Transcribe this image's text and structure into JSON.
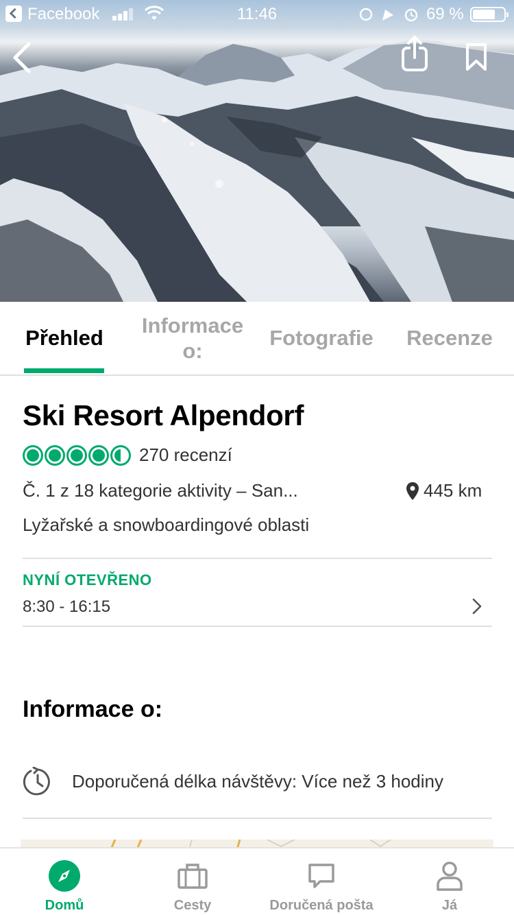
{
  "status_bar": {
    "back_app": "Facebook",
    "time": "11:46",
    "battery_percent": "69 %"
  },
  "hero": {
    "back_icon": "chevron-left-icon",
    "share_icon": "share-icon",
    "bookmark_icon": "bookmark-icon"
  },
  "tabs": [
    {
      "label": "Přehled",
      "active": true
    },
    {
      "label": "Informace o:",
      "active": false
    },
    {
      "label": "Fotografie",
      "active": false
    },
    {
      "label": "Recenze",
      "active": false
    }
  ],
  "attraction": {
    "name": "Ski Resort Alpendorf",
    "rating": 4.5,
    "reviews": "270 recenzí",
    "rank": "Č. 1 z 18 kategorie aktivity – San...",
    "distance": "445 km",
    "category": "Lyžařské a snowboardingové oblasti"
  },
  "hours": {
    "status": "NYNÍ OTEVŘENO",
    "time": "8:30 - 16:15"
  },
  "info": {
    "heading": "Informace o:",
    "duration": "Doporučená délka návštěvy: Více než 3 hodiny"
  },
  "bottom_nav": [
    {
      "label": "Domů",
      "icon": "compass-icon",
      "active": true
    },
    {
      "label": "Cesty",
      "icon": "suitcase-icon",
      "active": false
    },
    {
      "label": "Doručená pošta",
      "icon": "message-icon",
      "active": false
    },
    {
      "label": "Já",
      "icon": "person-icon",
      "active": false
    }
  ],
  "colors": {
    "accent": "#00aa6c",
    "inactive_tab": "#a7a7a7",
    "text": "#333333"
  }
}
